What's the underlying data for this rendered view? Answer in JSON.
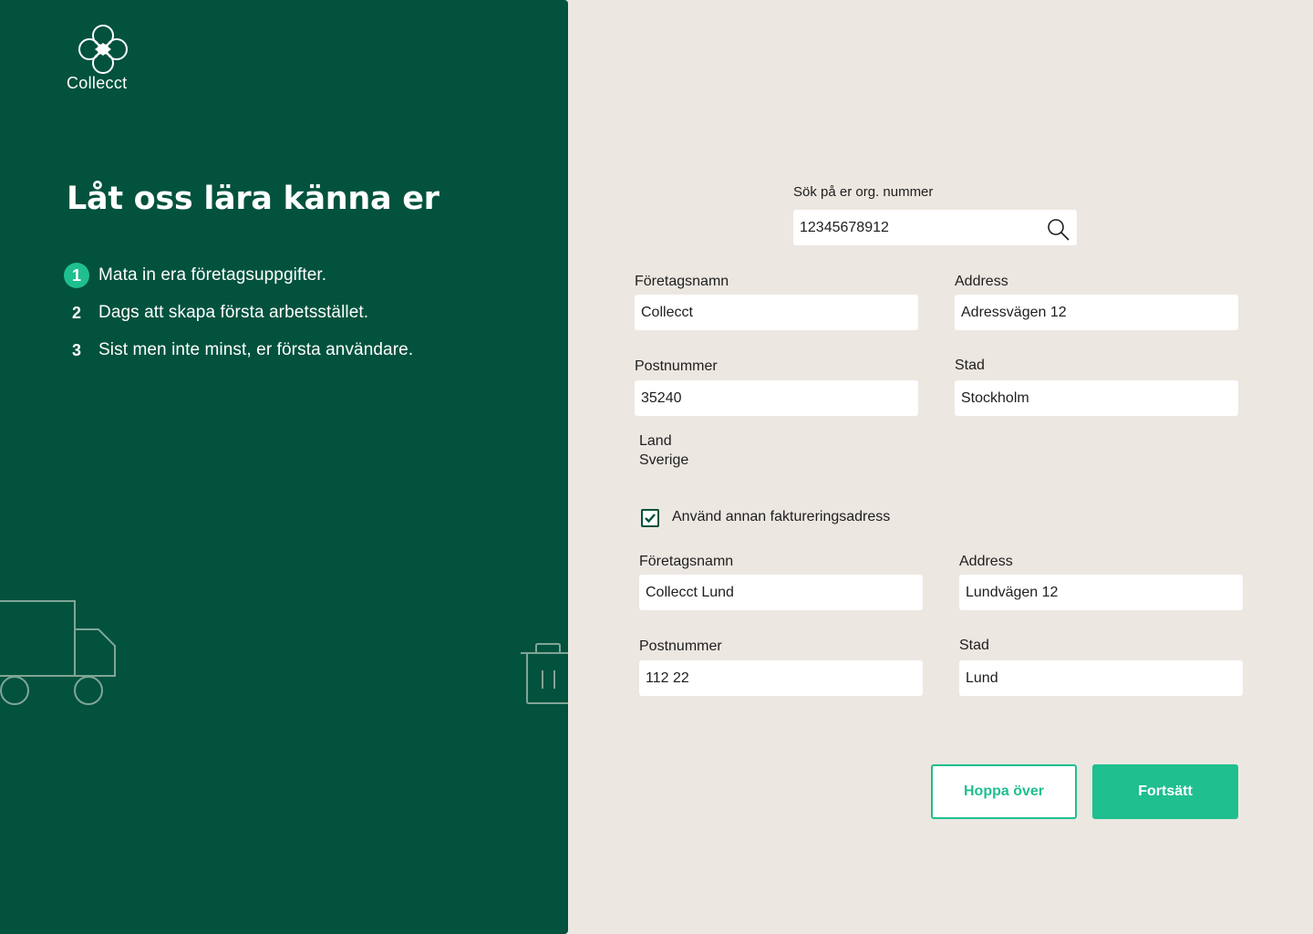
{
  "brand": {
    "name": "Collecct",
    "logo_icon": "clover-logo-icon",
    "panel_color": "#02523d",
    "accent_color": "#1fbf8f"
  },
  "intro": {
    "headline": "Låt oss lära känna er",
    "steps": [
      {
        "number": "1",
        "label": "Mata in era företagsuppgifter.",
        "active": true
      },
      {
        "number": "2",
        "label": "Dags att skapa första arbetsstället.",
        "active": false
      },
      {
        "number": "3",
        "label": "Sist men inte minst, er första användare.",
        "active": false
      }
    ],
    "illustrations": [
      "truck-icon",
      "trash-bin-icon"
    ]
  },
  "search": {
    "label": "Sök på er org. nummer",
    "value": "12345678912",
    "icon": "search-icon"
  },
  "company": {
    "name_label": "Företagsnamn",
    "name_value": "Collecct",
    "address_label": "Address",
    "address_value": "Adressvägen 12",
    "postal_label": "Postnummer",
    "postal_value": "35240",
    "city_label": "Stad",
    "city_value": "Stockholm",
    "country_label": "Land",
    "country_value": "Sverige"
  },
  "billing": {
    "checkbox_label": "Använd annan faktureringsadress",
    "checked": true,
    "name_label": "Företagsnamn",
    "name_value": "Collecct Lund",
    "address_label": "Address",
    "address_value": "Lundvägen 12",
    "postal_label": "Postnummer",
    "postal_value": "112 22",
    "city_label": "Stad",
    "city_value": "Lund"
  },
  "actions": {
    "skip_label": "Hoppa över",
    "continue_label": "Fortsätt"
  }
}
